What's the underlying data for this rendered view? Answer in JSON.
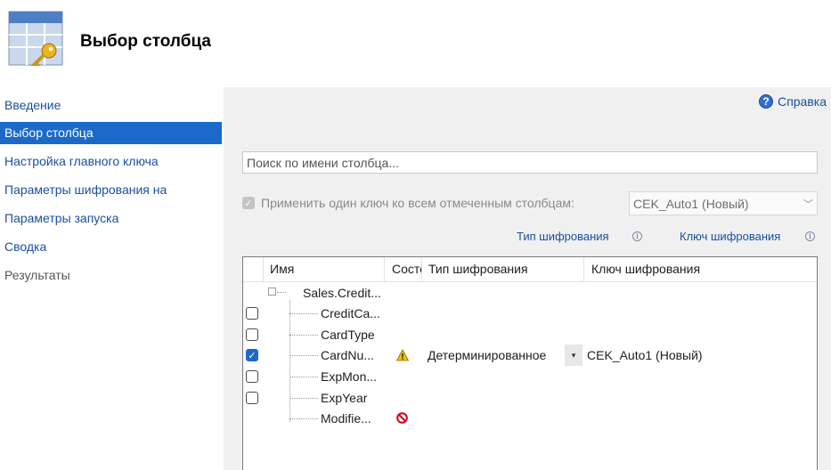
{
  "header": {
    "title": "Выбор столбца",
    "logo_icon": "table-key-icon"
  },
  "sidebar": {
    "items": [
      {
        "label": "Введение",
        "state": "link"
      },
      {
        "label": "Выбор столбца",
        "state": "active"
      },
      {
        "label": "Настройка главного ключа",
        "state": "link"
      },
      {
        "label": "Параметры шифрования на",
        "state": "link"
      },
      {
        "label": "Параметры запуска",
        "state": "link"
      },
      {
        "label": "Сводка",
        "state": "link"
      },
      {
        "label": "Результаты",
        "state": "disabled"
      }
    ]
  },
  "main": {
    "help_label": "Справка",
    "search_placeholder": "Поиск по имени столбца...",
    "apply_key_label": "Применить один ключ ко всем отмеченным столбцам:",
    "apply_key_checked": true,
    "key_select_value": "CEK_Auto1 (Новый)",
    "column_links": {
      "encryption_type": "Тип шифрования",
      "encryption_key": "Ключ шифрования"
    },
    "grid": {
      "headers": [
        "Имя",
        "Состо",
        "Тип шифрования",
        "Ключ шифрования"
      ],
      "table_name": "Sales.Credit...",
      "rows": [
        {
          "name": "CreditCa...",
          "checked": false,
          "status": "",
          "enc_type": "",
          "enc_key": ""
        },
        {
          "name": "CardType",
          "checked": false,
          "status": "",
          "enc_type": "",
          "enc_key": ""
        },
        {
          "name": "CardNu...",
          "checked": true,
          "status": "warning-icon",
          "enc_type": "Детерминированное",
          "enc_key": "CEK_Auto1 (Новый)"
        },
        {
          "name": "ExpMon...",
          "checked": false,
          "status": "",
          "enc_type": "",
          "enc_key": ""
        },
        {
          "name": "ExpYear",
          "checked": false,
          "status": "",
          "enc_type": "",
          "enc_key": ""
        },
        {
          "name": "Modifie...",
          "checked": null,
          "status": "blocked-icon",
          "enc_type": "",
          "enc_key": ""
        }
      ]
    }
  },
  "colors": {
    "accent": "#1b6ac9",
    "link": "#1a4fa0",
    "panel_bg": "#f0f0f0",
    "warning": "#f2c200",
    "error": "#d0021b"
  }
}
